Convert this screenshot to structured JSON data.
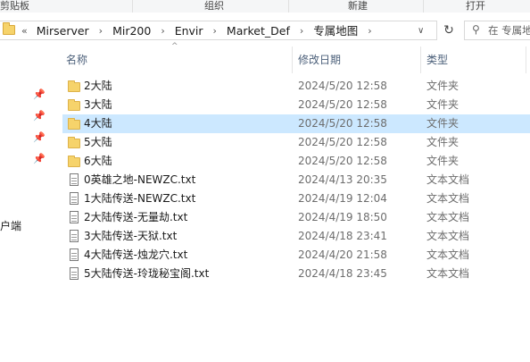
{
  "ribbon": {
    "groups": [
      "剪贴板",
      "组织",
      "新建",
      "打开"
    ]
  },
  "address": {
    "crumbs": [
      "Mirserver",
      "Mir200",
      "Envir",
      "Market_Def",
      "专属地图"
    ],
    "lead_chevrons": "«",
    "search_placeholder": "在 专属地图"
  },
  "nav": {
    "label": "客户端"
  },
  "columns": {
    "name": "名称",
    "date": "修改日期",
    "type": "类型"
  },
  "files": [
    {
      "name": "2大陆",
      "date": "2024/5/20 12:58",
      "type": "文件夹",
      "kind": "folder",
      "selected": false
    },
    {
      "name": "3大陆",
      "date": "2024/5/20 12:58",
      "type": "文件夹",
      "kind": "folder",
      "selected": false
    },
    {
      "name": "4大陆",
      "date": "2024/5/20 12:58",
      "type": "文件夹",
      "kind": "folder",
      "selected": true
    },
    {
      "name": "5大陆",
      "date": "2024/5/20 12:58",
      "type": "文件夹",
      "kind": "folder",
      "selected": false
    },
    {
      "name": "6大陆",
      "date": "2024/5/20 12:58",
      "type": "文件夹",
      "kind": "folder",
      "selected": false
    },
    {
      "name": "0英雄之地-NEWZC.txt",
      "date": "2024/4/13 20:35",
      "type": "文本文档",
      "kind": "txt",
      "selected": false
    },
    {
      "name": "1大陆传送-NEWZC.txt",
      "date": "2024/4/19 12:04",
      "type": "文本文档",
      "kind": "txt",
      "selected": false
    },
    {
      "name": "2大陆传送-无量劫.txt",
      "date": "2024/4/19 18:50",
      "type": "文本文档",
      "kind": "txt",
      "selected": false
    },
    {
      "name": "3大陆传送-天狱.txt",
      "date": "2024/4/18 23:41",
      "type": "文本文档",
      "kind": "txt",
      "selected": false
    },
    {
      "name": "4大陆传送-烛龙穴.txt",
      "date": "2024/4/20 21:58",
      "type": "文本文档",
      "kind": "txt",
      "selected": false
    },
    {
      "name": "5大陆传送-玲珑秘宝阁.txt",
      "date": "2024/4/18 23:45",
      "type": "文本文档",
      "kind": "txt",
      "selected": false
    }
  ],
  "colors": {
    "selection": "#cce8ff",
    "folder": "#f6d36b",
    "header_text": "#4c607a"
  }
}
